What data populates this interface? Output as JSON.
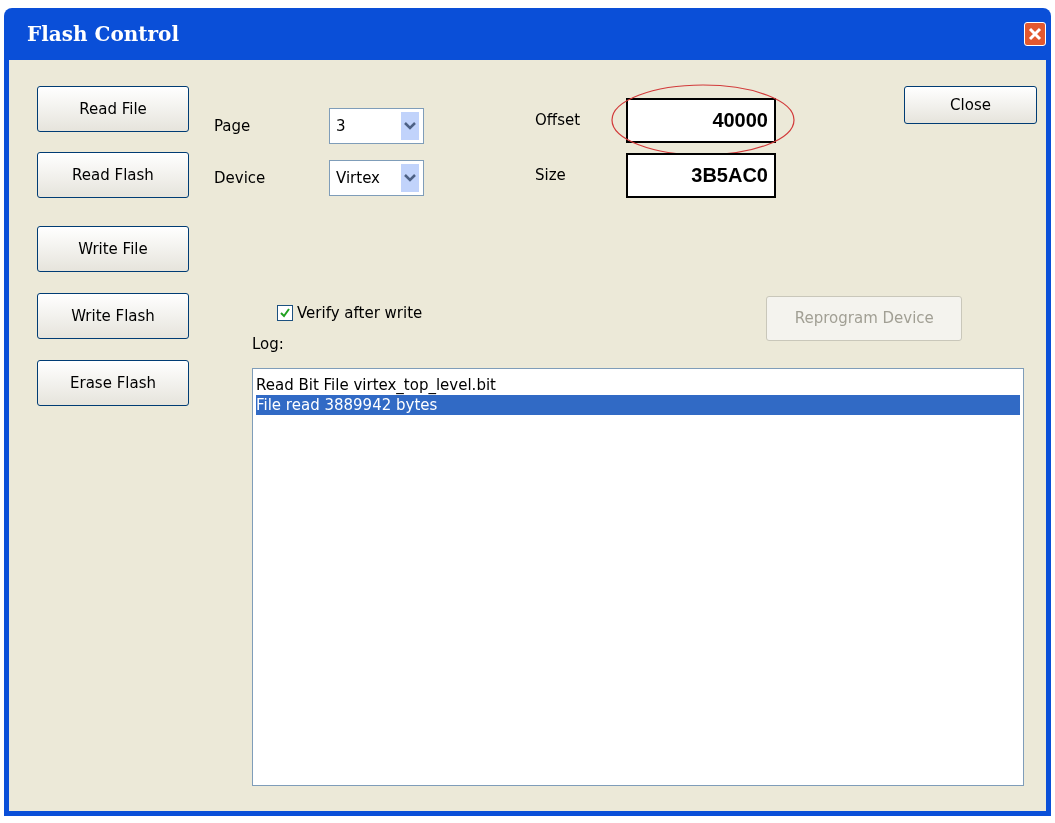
{
  "window": {
    "title": "Flash Control"
  },
  "action_buttons": [
    "Read File",
    "Read Flash",
    "Write File",
    "Write Flash",
    "Erase Flash"
  ],
  "selectors": [
    {
      "label": "Page",
      "value": "3"
    },
    {
      "label": "Device",
      "value": "Virtex"
    }
  ],
  "numbers": [
    {
      "label": "Offset",
      "value": "40000",
      "circled": true
    },
    {
      "label": "Size",
      "value": "3B5AC0",
      "circled": false
    }
  ],
  "close_button": "Close",
  "verify": {
    "label": "Verify after write",
    "checked": true
  },
  "reprogram_button": {
    "label": "Reprogram Device",
    "disabled": true
  },
  "log": {
    "label": "Log:",
    "lines": [
      {
        "text": "Read Bit File virtex_top_level.bit",
        "selected": false
      },
      {
        "text": "File read 3889942 bytes",
        "selected": true
      }
    ]
  }
}
